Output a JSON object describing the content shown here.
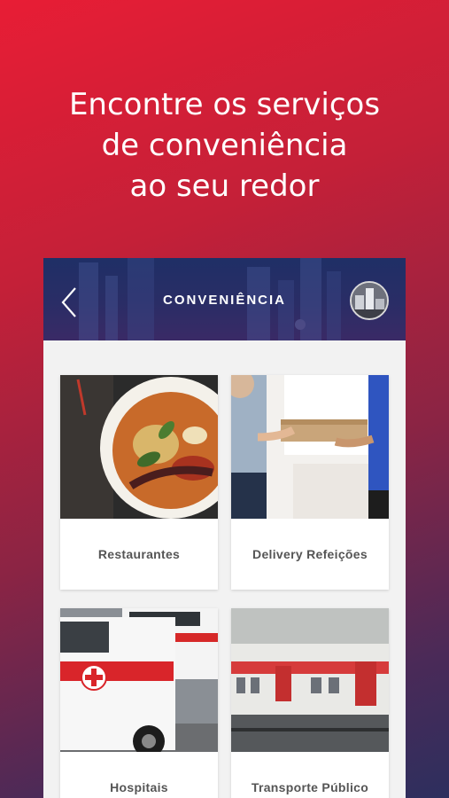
{
  "headline": {
    "line1": "Encontre os serviços",
    "line2": "de conveniência",
    "line3": "ao seu redor"
  },
  "appbar": {
    "title": "CONVENIÊNCIA",
    "back_icon": "chevron-left-icon",
    "avatar_icon": "user-avatar"
  },
  "categories": [
    {
      "label": "Restaurantes"
    },
    {
      "label": "Delivery Refeições"
    },
    {
      "label": "Hospitais"
    },
    {
      "label": "Transporte Público"
    }
  ],
  "colors": {
    "brand_red": "#e81d35",
    "navy": "#2d2f5e",
    "appbar": "#23306a"
  }
}
